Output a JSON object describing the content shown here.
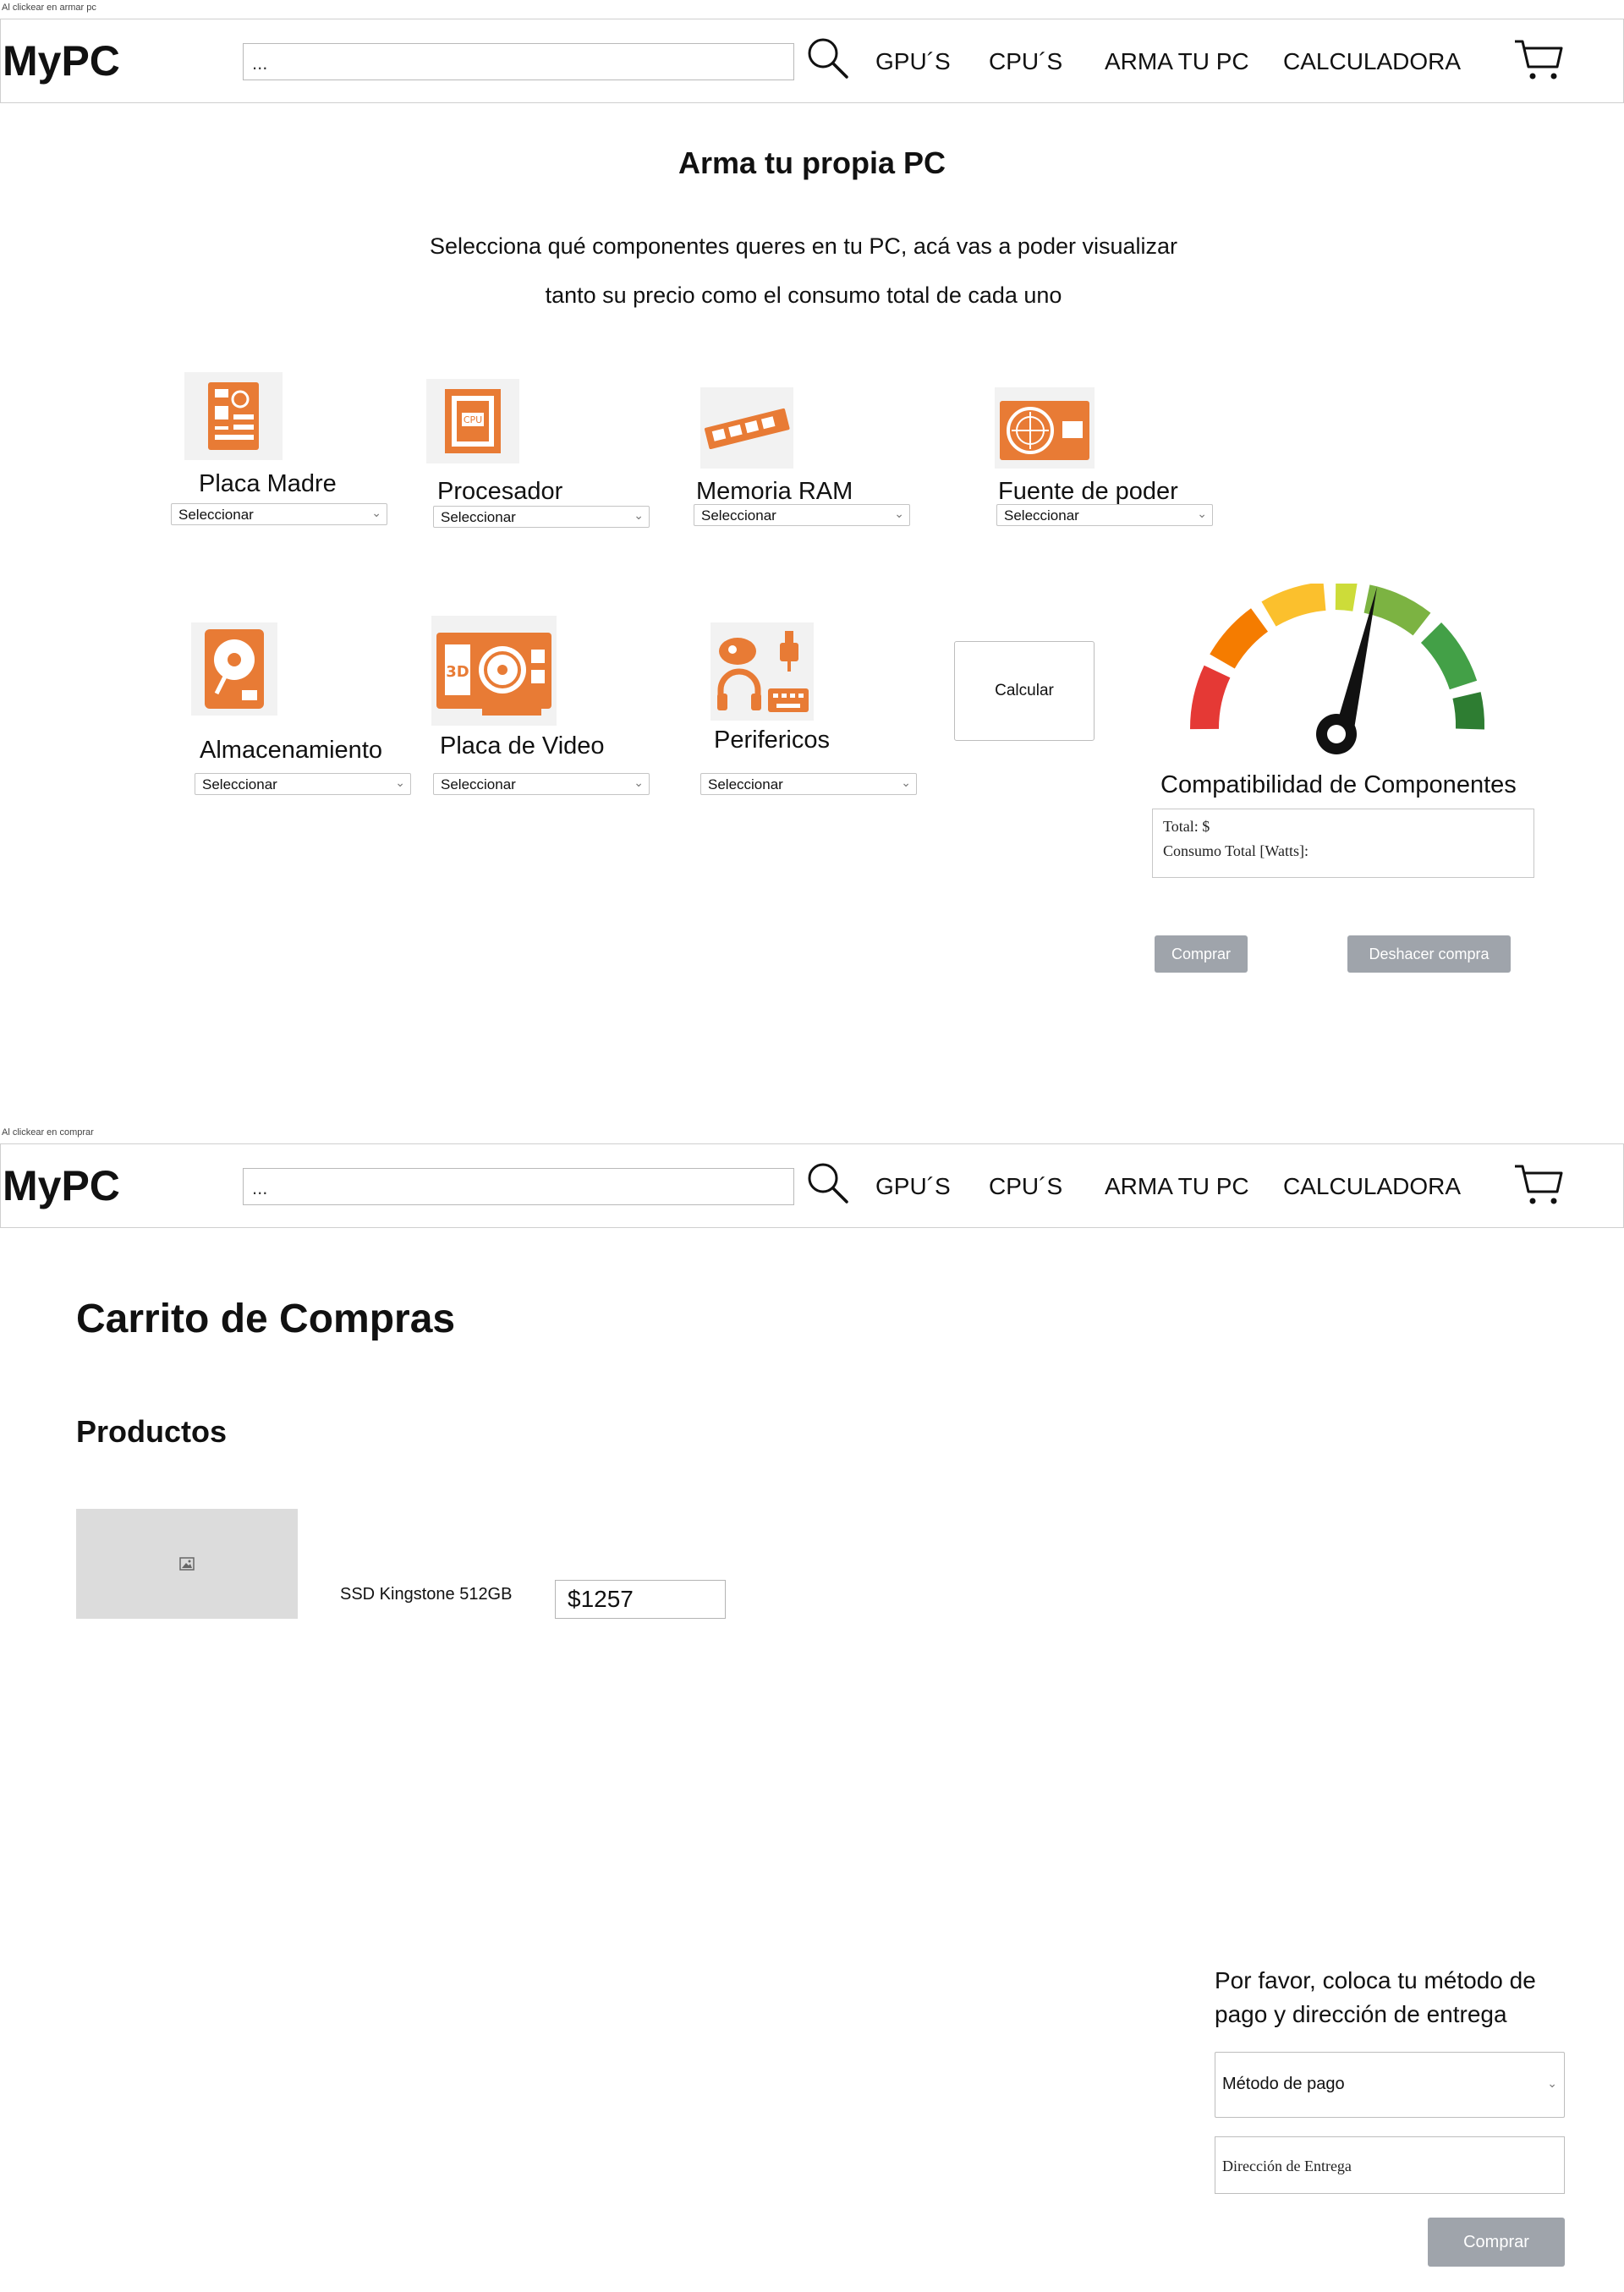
{
  "screens": [
    {
      "caption": "Al clickear en armar pc",
      "navbar": {
        "logo": "MyPC",
        "search_value": "...",
        "links": [
          "GPU´S",
          "CPU´S",
          "ARMA TU PC",
          "CALCULADORA"
        ]
      },
      "title": "Arma tu propia PC",
      "description": [
        "Selecciona qué componentes queres en tu PC, acá vas a poder visualizar",
        "tanto su precio como el consumo total de cada uno"
      ],
      "components": [
        {
          "label": "Placa Madre",
          "select": "Seleccionar",
          "icon": "motherboard-icon"
        },
        {
          "label": "Procesador",
          "select": "Seleccionar",
          "icon": "cpu-icon"
        },
        {
          "label": "Memoria RAM",
          "select": "Seleccionar",
          "icon": "ram-icon"
        },
        {
          "label": "Fuente de poder",
          "select": "Seleccionar",
          "icon": "power-supply-icon"
        },
        {
          "label": "Almacenamiento",
          "select": "Seleccionar",
          "icon": "hard-drive-icon"
        },
        {
          "label": "Placa de Video",
          "select": "Seleccionar",
          "icon": "graphics-card-icon"
        },
        {
          "label": "Perifericos",
          "select": "Seleccionar",
          "icon": "peripherals-icon"
        }
      ],
      "calc_button": "Calcular",
      "compatibility_title": "Compatibilidad de Componentes",
      "totals": {
        "total": "Total: $",
        "consumo": "Consumo Total [Watts]:"
      },
      "buy_button": "Comprar",
      "undo_button": "Deshacer compra"
    },
    {
      "caption": "Al clickear en comprar",
      "navbar": {
        "logo": "MyPC",
        "search_value": "...",
        "links": [
          "GPU´S",
          "CPU´S",
          "ARMA TU PC",
          "CALCULADORA"
        ]
      },
      "cart_title": "Carrito de Compras",
      "products_title": "Productos",
      "products": [
        {
          "name": "SSD Kingstone 512GB",
          "price": "$1257"
        }
      ],
      "payment_prompt": "Por favor, coloca tu método de pago y dirección de entrega",
      "payment_method_placeholder": "Método de pago",
      "address_placeholder": "Dirección de Entrega",
      "buy_button": "Comprar"
    }
  ],
  "colors": {
    "accent_orange": "#e87b35",
    "button_gray": "#9fa4ab",
    "gauge_red": "#e53935",
    "gauge_orange": "#f57c00",
    "gauge_yellow": "#fbc02d",
    "gauge_green": "#43a047"
  }
}
